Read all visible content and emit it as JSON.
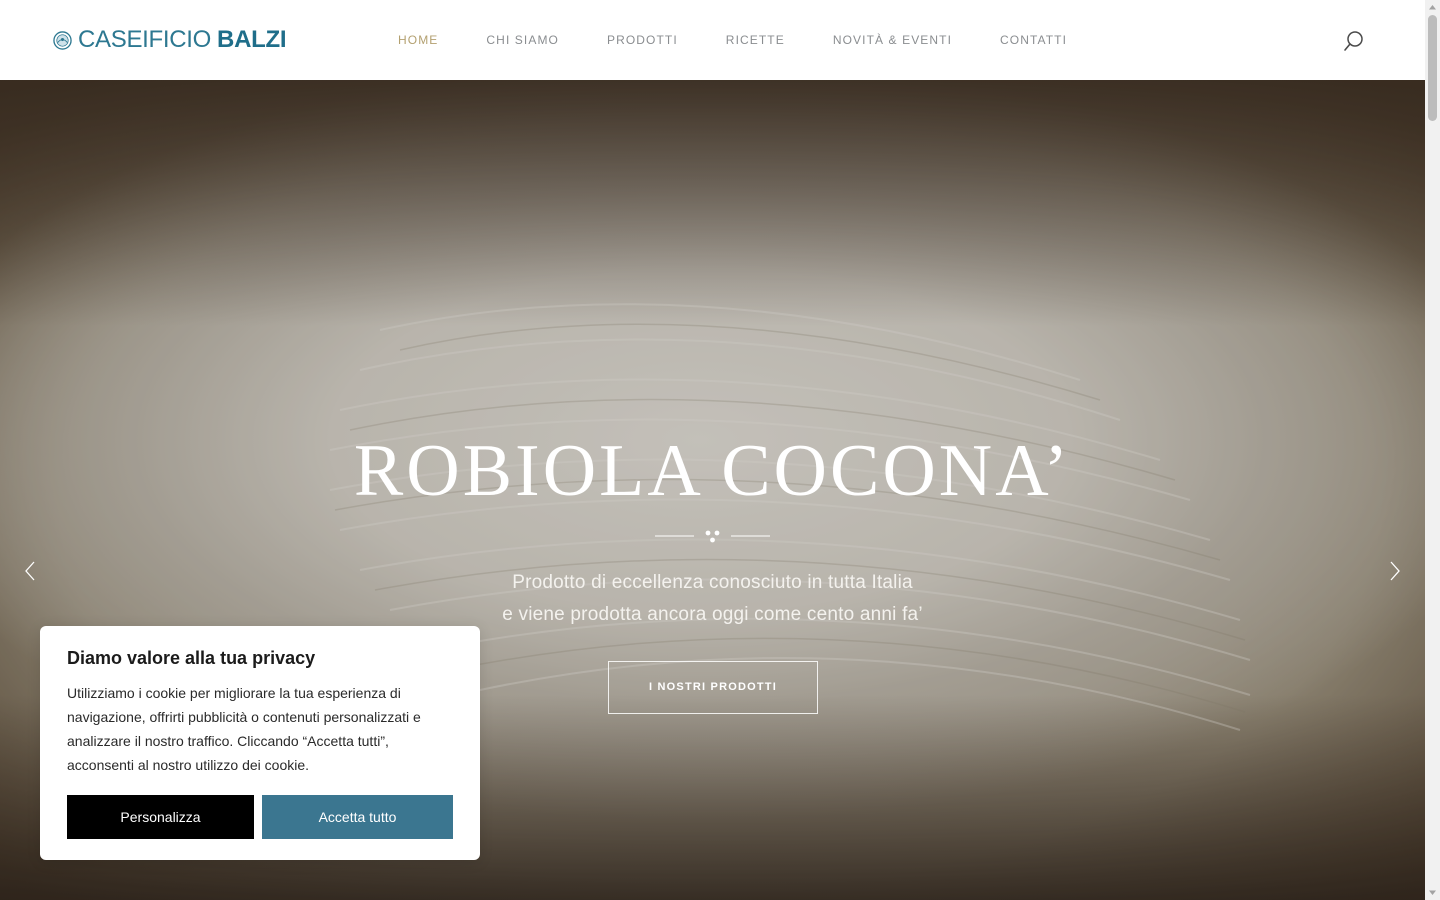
{
  "brand": {
    "logo_light": "CASEIFICIO",
    "logo_bold": "BALZI",
    "primary_color": "#2d7891",
    "accent_color": "#b3a070"
  },
  "nav": {
    "items": [
      {
        "label": "HOME",
        "active": true
      },
      {
        "label": "CHI SIAMO",
        "active": false
      },
      {
        "label": "PRODOTTI",
        "active": false
      },
      {
        "label": "RICETTE",
        "active": false
      },
      {
        "label": "NOVITÀ & EVENTI",
        "active": false
      },
      {
        "label": "CONTATTI",
        "active": false
      }
    ],
    "search_icon": "search-icon"
  },
  "hero": {
    "title": "ROBIOLA COCONA’",
    "subtitle_line1": "Prodotto di eccellenza conosciuto in tutta Italia",
    "subtitle_line2": "e viene prodotta ancora oggi come cento anni fa’",
    "cta_label": "I NOSTRI PRODOTTI",
    "prev_icon": "chevron-left-icon",
    "next_icon": "chevron-right-icon"
  },
  "cookie_banner": {
    "title": "Diamo valore alla tua privacy",
    "text": "Utilizziamo i cookie per migliorare la tua esperienza di navigazione, offrirti pubblicità o contenuti personalizzati e analizzare il nostro traffico. Cliccando “Accetta tutti”, acconsenti al nostro utilizzo dei cookie.",
    "customize_label": "Personalizza",
    "accept_label": "Accetta tutto",
    "accept_color": "#3b7690"
  }
}
